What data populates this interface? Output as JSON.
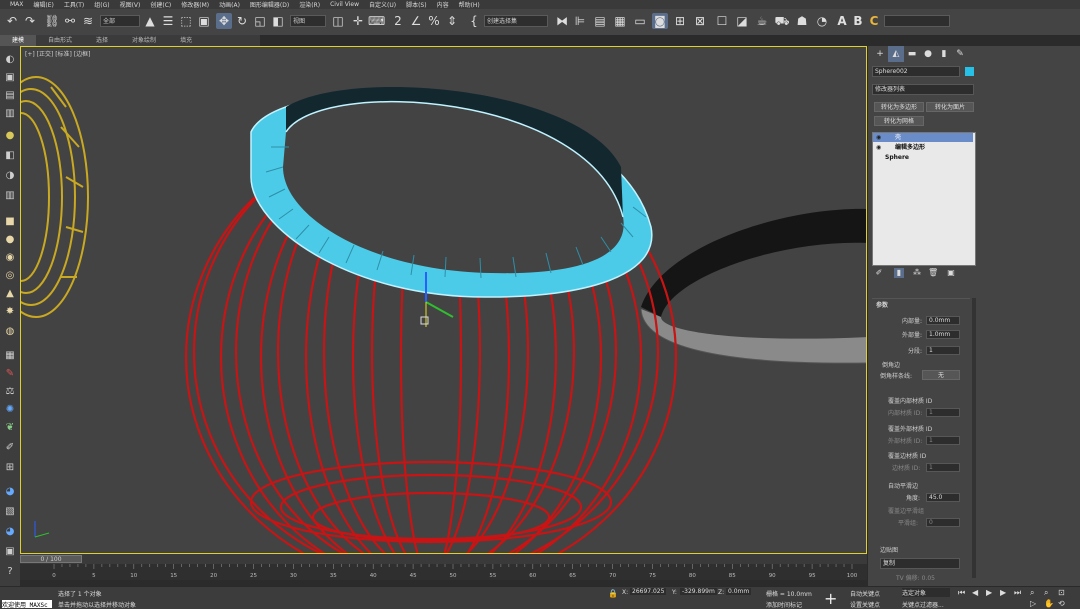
{
  "menubar": {
    "items": [
      "MAX",
      "编辑(E)",
      "工具(T)",
      "组(G)",
      "视图(V)",
      "创建(C)",
      "修改器(M)",
      "动画(A)",
      "图形编辑器(D)",
      "渲染(R)",
      "Civil View",
      "自定义(U)",
      "脚本(S)",
      "内容",
      "帮助(H)"
    ]
  },
  "toolbar": {
    "selection_filter": "全部",
    "ref_coord": "视图",
    "named_selection": "创建选择集",
    "text_a": "A",
    "text_b": "B",
    "text_c": "C"
  },
  "ribbon": {
    "tabs": [
      "建模",
      "自由形式",
      "选择",
      "对象绘制",
      "填充"
    ]
  },
  "viewport": {
    "label": "[+] [正交] [标准] [边框]"
  },
  "timeslider": {
    "position": "0 / 100",
    "ticks": [
      "0",
      "5",
      "10",
      "15",
      "20",
      "25",
      "30",
      "35",
      "40",
      "45",
      "50",
      "55",
      "60",
      "65",
      "70",
      "75",
      "80",
      "85",
      "90",
      "95",
      "100"
    ]
  },
  "command_panel": {
    "object_name": "Sphere002",
    "object_color": "#27c0e6",
    "modifier_list": "修改器列表",
    "btn_to_poly": "转化为多边形",
    "btn_to_patch": "转化为面片",
    "btn_to_mesh": "转化为网格",
    "stack": [
      "壳",
      "编辑多边形",
      "Sphere"
    ],
    "params_title": "参数",
    "inner_amount_label": "内部量:",
    "inner_amount": "0.0mm",
    "outer_amount_label": "外部量:",
    "outer_amount": "1.0mm",
    "segments_label": "分段:",
    "segments": "1",
    "bevel_edges": "倒角边",
    "bevel_spline_label": "倒角样条线:",
    "bevel_spline_value": "无",
    "override_inner_mat": "覆盖内部材质 ID",
    "inner_mat_label": "内部材质 ID:",
    "inner_mat": "1",
    "override_outer_mat": "覆盖外部材质 ID",
    "outer_mat_label": "外部材质 ID:",
    "outer_mat": "1",
    "override_edge_mat": "覆盖边材质 ID",
    "edge_mat_label": "边材质 ID:",
    "edge_mat": "1",
    "auto_smooth": "自动平滑边",
    "angle_label": "角度:",
    "angle": "45.0",
    "override_edge_smooth": "覆盖边平滑组",
    "smooth_group_label": "平滑组:",
    "smooth_group": "0",
    "edge_mapping_label": "边贴图",
    "edge_mapping": "复制",
    "tv_offset": "TV 偏移: 0.05"
  },
  "status": {
    "welcome": "欢迎使用 MAXSc",
    "selected": "选择了 1 个对象",
    "hint": "单击并拖动以选择并移动对象",
    "x_label": "X:",
    "x": "26697.025",
    "y_label": "Y:",
    "y": "-329.899m",
    "z_label": "Z:",
    "z": "0.0mm",
    "grid": "栅格 = 10.0mm",
    "add_time_tag": "添加时间标记",
    "auto_key": "自动关键点",
    "selected_obj": "选定对象",
    "set_key": "设置关键点",
    "key_filter": "关键点过滤器..."
  }
}
